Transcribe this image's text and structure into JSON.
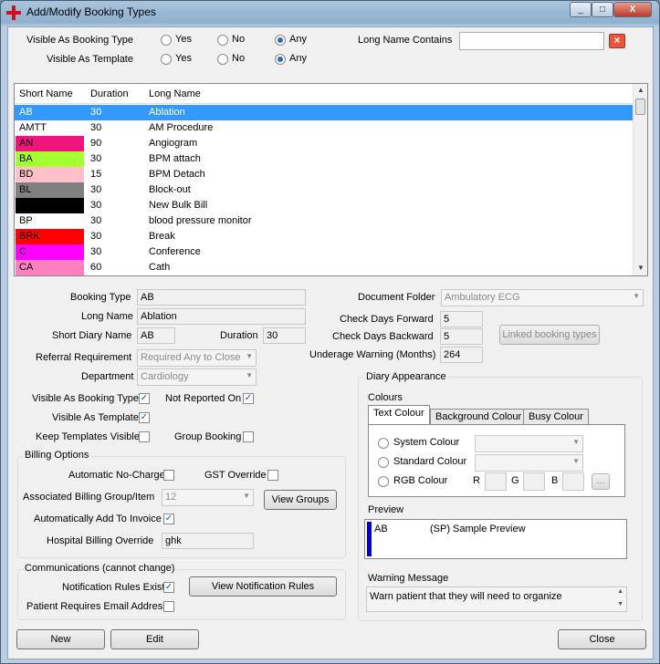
{
  "window": {
    "title": "Add/Modify Booking Types",
    "min": "_",
    "max": "□",
    "close": "X"
  },
  "filters": {
    "visible_booking_type": "Visible As Booking Type",
    "visible_template": "Visible As Template",
    "yes": "Yes",
    "no": "No",
    "any": "Any",
    "long_name_contains": "Long Name Contains",
    "clear": "×"
  },
  "list": {
    "columns": [
      "Short Name",
      "Duration",
      "Long Name"
    ],
    "rows": [
      {
        "short": "AB",
        "duration": "30",
        "long": "Ablation",
        "color": "",
        "selected": true
      },
      {
        "short": "AMTT",
        "duration": "30",
        "long": "AM Procedure",
        "color": ""
      },
      {
        "short": "AN",
        "duration": "90",
        "long": "Angiogram",
        "color": "#f0147c"
      },
      {
        "short": "BA",
        "duration": "30",
        "long": "BPM attach",
        "color": "#a6ff2e"
      },
      {
        "short": "BD",
        "duration": "15",
        "long": "BPM Detach",
        "color": "#ffc0cb"
      },
      {
        "short": "BL",
        "duration": "30",
        "long": "Block-out",
        "color": "#808080"
      },
      {
        "short": "",
        "duration": "30",
        "long": "New Bulk Bill",
        "color": "#000000"
      },
      {
        "short": "BP",
        "duration": "30",
        "long": "blood pressure monitor",
        "color": ""
      },
      {
        "short": "BRK",
        "duration": "30",
        "long": "Break",
        "color": "#ff0000"
      },
      {
        "short": "C",
        "duration": "30",
        "long": "Conference",
        "color": "#ff00ff"
      },
      {
        "short": "CA",
        "duration": "60",
        "long": "Cath",
        "color": "#ff7fbf"
      }
    ]
  },
  "detail": {
    "booking_type_label": "Booking Type",
    "booking_type": "AB",
    "long_name_label": "Long Name",
    "long_name": "Ablation",
    "short_diary_label": "Short Diary Name",
    "short_diary": "AB",
    "duration_label": "Duration",
    "duration": "30",
    "referral_label": "Referral Requirement",
    "referral": "Required Any to Close",
    "department_label": "Department",
    "department": "Cardiology",
    "vis_booking_label": "Visible As Booking Type",
    "not_reported_label": "Not Reported On",
    "vis_template_label": "Visible As Template",
    "keep_templates_label": "Keep Templates Visible",
    "group_booking_label": "Group Booking",
    "check": "✓"
  },
  "billing": {
    "title": "Billing Options",
    "auto_nocharge": "Automatic No-Charge",
    "gst_override": "GST Override",
    "assoc_label": "Associated Billing Group/Item",
    "assoc_value": "12",
    "view_groups": "View Groups",
    "auto_add": "Automatically Add To Invoice",
    "hospital_label": "Hospital Billing Override",
    "hospital_value": "ghk"
  },
  "comms": {
    "title": "Communications (cannot change)",
    "notif_exist": "Notification Rules Exist",
    "view_notif": "View Notification Rules",
    "email_req": "Patient Requires Email Address"
  },
  "right": {
    "doc_folder_label": "Document Folder",
    "doc_folder": "Ambulatory ECG",
    "check_fwd_label": "Check Days Forward",
    "check_fwd": "5",
    "check_bwd_label": "Check Days Backward",
    "check_bwd": "5",
    "underage_label": "Underage Warning (Months)",
    "underage": "264",
    "linked": "Linked booking types"
  },
  "diary": {
    "title": "Diary Appearance",
    "colours": "Colours",
    "tabs": [
      "Text Colour",
      "Background Colour",
      "Busy Colour"
    ],
    "system": "System Colour",
    "standard": "Standard Colour",
    "rgb": "RGB Colour",
    "r": "R",
    "g": "G",
    "b": "B",
    "dots": "...",
    "preview_label": "Preview",
    "preview_short": "AB",
    "preview_text": "(SP) Sample Preview",
    "warning_label": "Warning Message",
    "warning_text": "Warn patient that they will need to organize",
    "preview_bar": "#0000c8"
  },
  "footer": {
    "new": "New",
    "edit": "Edit",
    "close": "Close"
  }
}
